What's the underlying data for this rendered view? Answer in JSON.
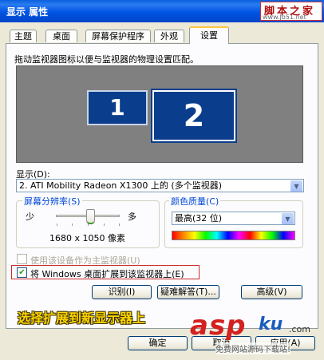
{
  "window": {
    "title": "显示 属性",
    "watermark_chars": "脚本之家",
    "watermark_site": "www.Jb51.net"
  },
  "tabs": [
    {
      "label": "主题"
    },
    {
      "label": "桌面"
    },
    {
      "label": "屏幕保护程序"
    },
    {
      "label": "外观"
    },
    {
      "label": "设置"
    }
  ],
  "active_tab": "设置",
  "settings": {
    "instruction": "拖动监视器图标以便与监视器的物理设置匹配。",
    "monitors": [
      "1",
      "2"
    ],
    "display_label": "显示(D):",
    "display_value": "2. ATI Mobility Radeon X1300 上的 (多个监视器)",
    "resolution": {
      "group_label": "屏幕分辨率(S)",
      "less_label": "少",
      "more_label": "多",
      "value": "1680 x 1050 像素"
    },
    "color_quality": {
      "group_label": "颜色质量(C)",
      "value": "最高(32 位)"
    },
    "primary_checkbox": {
      "label": "使用该设备作为主监视器(U)",
      "checked": false,
      "enabled": false
    },
    "extend_checkbox": {
      "label": "将 Windows 桌面扩展到该监视器上(E)",
      "checked": true,
      "enabled": true
    },
    "buttons": {
      "identify": "识别(I)",
      "troubleshoot": "疑难解答(T)...",
      "advanced": "高级(V)"
    }
  },
  "caption": "选择扩展到新显示器上",
  "footer_buttons": {
    "ok": "确定",
    "cancel": "取消",
    "apply": "应用(A)"
  },
  "watermark_bottom": {
    "asp": "asp",
    "kt": "ku",
    "com": ".com",
    "sub": "免费网站源码下载站!"
  }
}
